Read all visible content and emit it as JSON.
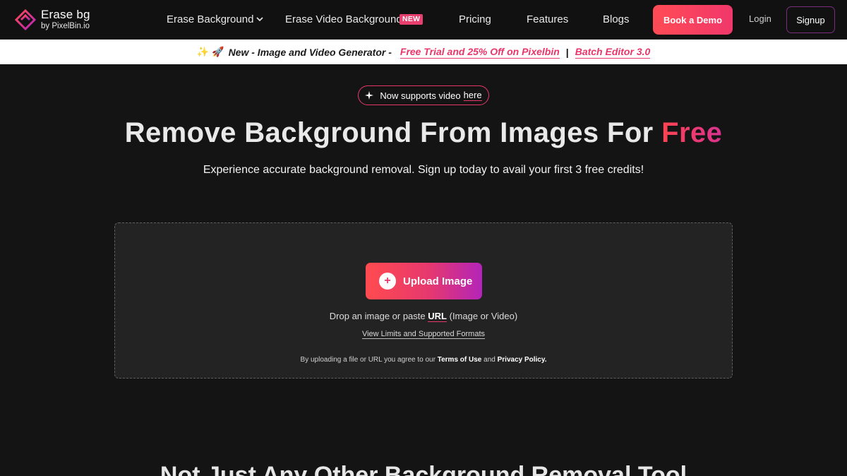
{
  "brand": {
    "title": "Erase bg",
    "subtitle": "by PixelBin.io"
  },
  "nav": {
    "erase_background": "Erase Background",
    "erase_video_background": "Erase Video Background",
    "new_badge": "NEW",
    "pricing": "Pricing",
    "features": "Features",
    "blogs": "Blogs",
    "book_demo": "Book a Demo",
    "login": "Login",
    "signup": "Signup"
  },
  "banner": {
    "emoji_sparkles": "✨",
    "emoji_rocket": "🚀",
    "lead": "New - Image and Video Generator -",
    "promo_link": "Free Trial and 25% Off on Pixelbin",
    "separator": "|",
    "batch_link": "Batch Editor 3.0"
  },
  "hero": {
    "pill_icon": "sparkle-icon",
    "pill_text": "Now supports video",
    "pill_link": "here",
    "title_main": "Remove Background From Images For",
    "title_accent": "Free",
    "subtitle": "Experience accurate background removal. Sign up today to avail your first 3 free credits!"
  },
  "upload": {
    "button_icon": "plus-icon",
    "button_label": "Upload Image",
    "drop_text_before": "Drop an image or paste",
    "drop_text_url": "URL",
    "drop_text_after": "(Image or Video)",
    "limits_link": "View Limits and Supported Formats",
    "terms_before": "By uploading a file or URL you agree to our",
    "terms_link": "Terms of Use",
    "terms_and": "and",
    "privacy_link": "Privacy Policy."
  },
  "section2": {
    "title": "Not Just Any Other Background Removal Tool"
  },
  "colors": {
    "background": "#141414",
    "accent_red": "#ff4b55",
    "accent_pink": "#e8356a",
    "accent_purple": "#b424b9"
  }
}
